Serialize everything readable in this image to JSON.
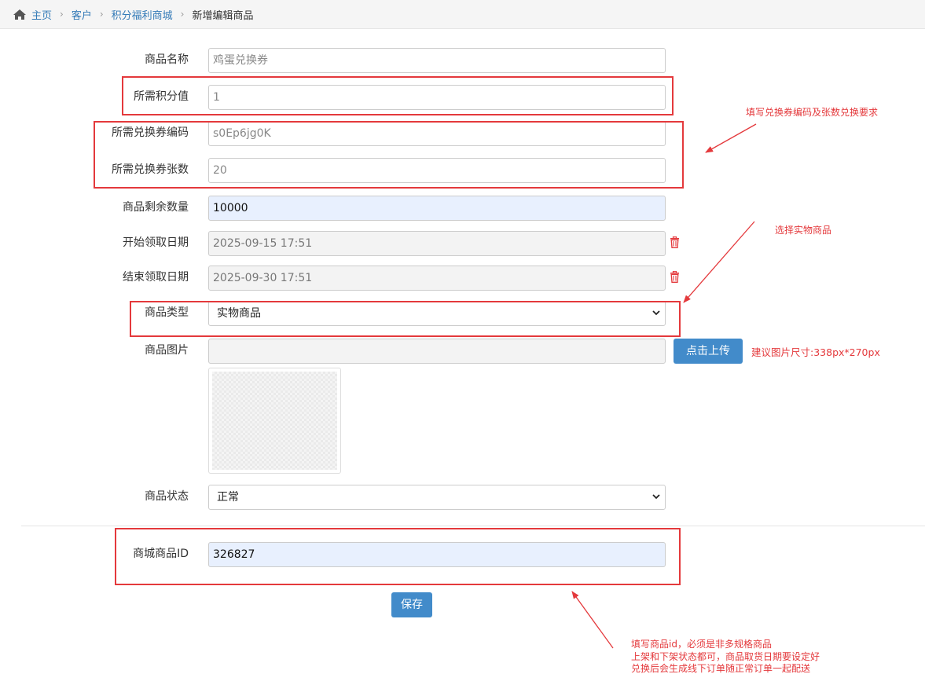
{
  "breadcrumb": {
    "items": [
      "主页",
      "客户",
      "积分福利商城"
    ],
    "current": "新增编辑商品"
  },
  "form": {
    "name": {
      "label": "商品名称",
      "placeholder": "鸡蛋兑换券"
    },
    "points": {
      "label": "所需积分值",
      "placeholder": "1"
    },
    "coupon_code": {
      "label": "所需兑换券编码",
      "placeholder": "s0Ep6jg0K"
    },
    "coupon_count": {
      "label": "所需兑换券张数",
      "placeholder": "20"
    },
    "stock": {
      "label": "商品剩余数量",
      "value": "10000"
    },
    "start_date": {
      "label": "开始领取日期",
      "value": "2025-09-15 17:51"
    },
    "end_date": {
      "label": "结束领取日期",
      "value": "2025-09-30 17:51"
    },
    "type": {
      "label": "商品类型",
      "selected": "实物商品"
    },
    "image": {
      "label": "商品图片",
      "upload_label": "点击上传",
      "hint": "建议图片尺寸:338px*270px"
    },
    "status": {
      "label": "商品状态",
      "selected": "正常"
    },
    "mall_id": {
      "label": "商城商品ID",
      "value": "326827"
    },
    "save_label": "保存"
  },
  "annotations": {
    "coupon_note": "填写兑换券编码及张数兑换要求",
    "type_note": "选择实物商品",
    "id_note_lines": [
      "填写商品id，必须是非多规格商品",
      "上架和下架状态都可，商品取货日期要设定好",
      "兑换后会生成线下订单随正常订单一起配送"
    ]
  },
  "colors": {
    "link": "#337ab7",
    "primary_button": "#428bca",
    "annotation_red": "#e4393c"
  },
  "icons": [
    "home-icon",
    "chevron-right-icon",
    "trash-icon",
    "chevron-down-icon"
  ]
}
